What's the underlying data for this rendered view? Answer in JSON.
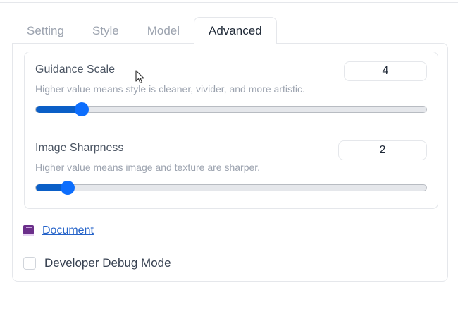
{
  "tabs": [
    {
      "label": "Setting",
      "active": false
    },
    {
      "label": "Style",
      "active": false
    },
    {
      "label": "Model",
      "active": false
    },
    {
      "label": "Advanced",
      "active": true
    }
  ],
  "sliders": [
    {
      "label": "Guidance Scale",
      "info": "Higher value means style is cleaner, vivider, and more artistic.",
      "value": "4",
      "level_fraction": 0.118
    },
    {
      "label": "Image Sharpness",
      "info": "Higher value means image and texture are sharper.",
      "value": "2",
      "level_fraction": 0.081
    }
  ],
  "document_link": {
    "label": "Document",
    "icon": "book-icon"
  },
  "debug_checkbox": {
    "label": "Developer Debug Mode",
    "checked": false
  },
  "colors": {
    "accent": "#0d6efd",
    "fill": "#0b5fc7",
    "link": "#2563c9"
  }
}
